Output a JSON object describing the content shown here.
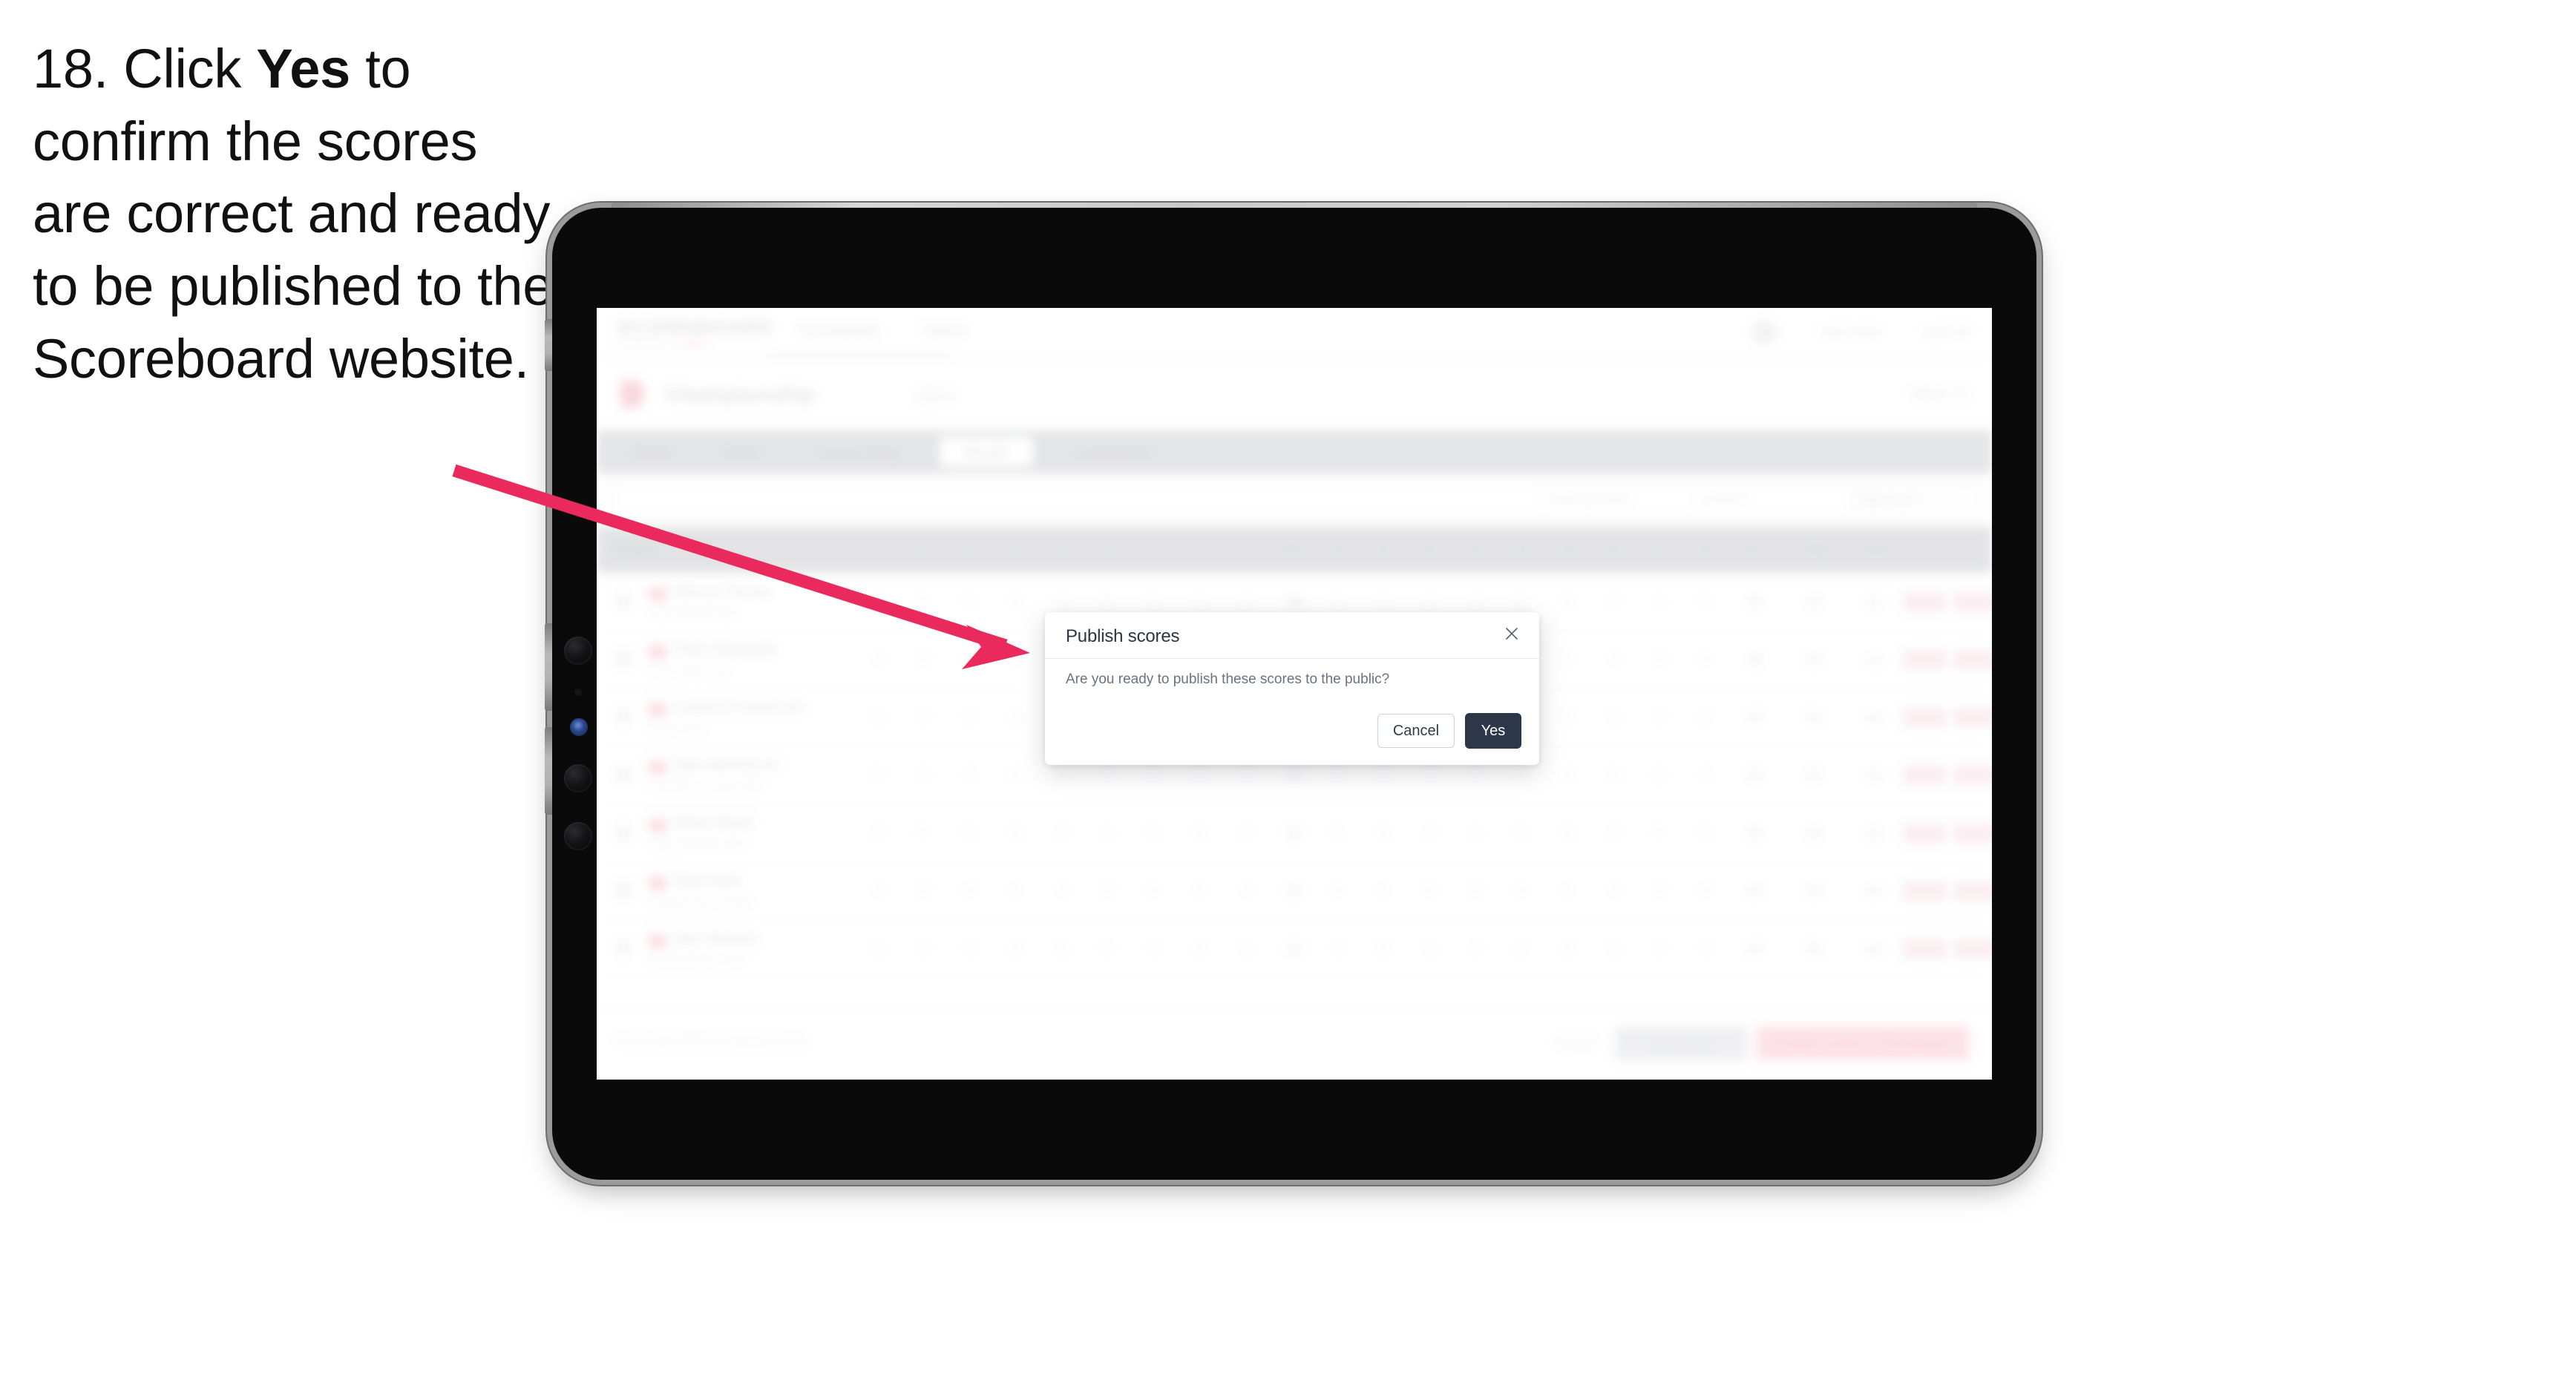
{
  "instruction": {
    "step_number": "18.",
    "text_before": " Click ",
    "emphasis": "Yes",
    "text_after": " to confirm the scores are correct and ready to be published to the Scoreboard website."
  },
  "annotation": {
    "arrow_color": "#ea2a5c",
    "points_to": "modal-dialog"
  },
  "device": {
    "type": "tablet",
    "orientation": "landscape",
    "bezel_color": "#0a0a0a",
    "frame_color": "#9b9b9b"
  },
  "app": {
    "brand": {
      "logo": "SCOREBOARD",
      "tagline": "POWERED BY",
      "tagline_accent": "GOLF"
    },
    "nav": {
      "links": [
        "Tournaments",
        "Teams"
      ],
      "user": "Tom Coles",
      "signout": "Sign out"
    },
    "page": {
      "title": "Championship",
      "meta": "2024",
      "right_label": "Week 12"
    },
    "tabs": [
      {
        "label": "Details",
        "active": false
      },
      {
        "label": "Teams",
        "active": false
      },
      {
        "label": "Course Setup",
        "active": false
      },
      {
        "label": "Results",
        "active": true
      },
      {
        "label": "Leaderboard",
        "active": false
      }
    ],
    "filters": {
      "search_placeholder": "Search players",
      "select_1": "Filter by round",
      "select_2": "Round 1",
      "select_3": "Table view"
    },
    "table": {
      "player_header": "Player",
      "hole_headers": [
        "1",
        "2",
        "3",
        "4",
        "5",
        "6",
        "7",
        "8",
        "9",
        "OUT",
        "10",
        "11",
        "12",
        "13",
        "14",
        "15",
        "16",
        "17",
        "18",
        "IN"
      ],
      "total_header": "Total",
      "score_header": "Score",
      "rows": [
        {
          "name": "Marcus Turner",
          "club": "Oak Hill Golf Club",
          "holes": [
            "4",
            "5",
            "3",
            "4",
            "4",
            "5",
            "4",
            "3",
            "4",
            "36",
            "4",
            "4",
            "5",
            "3",
            "4",
            "4",
            "5",
            "4",
            "4",
            "37"
          ],
          "total": "73",
          "score": "+1",
          "pill_a": "R1",
          "pill_b": "73"
        },
        {
          "name": "Peter Reynolds",
          "club": "Pine Valley Club",
          "holes": [
            "4",
            "4",
            "4",
            "5",
            "3",
            "4",
            "4",
            "4",
            "5",
            "37",
            "3",
            "5",
            "4",
            "4",
            "4",
            "5",
            "4",
            "3",
            "4",
            "36"
          ],
          "total": "73",
          "score": "+1",
          "pill_a": "R1",
          "pill_b": "73"
        },
        {
          "name": "Cameron Anderson",
          "club": "Royal Links",
          "holes": [
            "5",
            "4",
            "3",
            "4",
            "4",
            "4",
            "5",
            "4",
            "4",
            "37",
            "4",
            "4",
            "4",
            "5",
            "3",
            "4",
            "4",
            "4",
            "5",
            "37"
          ],
          "total": "74",
          "score": "+2",
          "pill_a": "R1",
          "pill_b": "74"
        },
        {
          "name": "Dale Westwood",
          "club": "Riverside Country Club",
          "holes": [
            "4",
            "4",
            "4",
            "4",
            "5",
            "3",
            "4",
            "5",
            "4",
            "37",
            "4",
            "5",
            "4",
            "4",
            "4",
            "4",
            "3",
            "5",
            "4",
            "37"
          ],
          "total": "74",
          "score": "+2",
          "pill_a": "R1",
          "pill_b": "74"
        },
        {
          "name": "Oliver Reed",
          "club": "Highland Golf Links",
          "holes": [
            "4",
            "5",
            "4",
            "3",
            "4",
            "4",
            "4",
            "4",
            "5",
            "37",
            "5",
            "4",
            "4",
            "4",
            "4",
            "3",
            "4",
            "5",
            "4",
            "37"
          ],
          "total": "74",
          "score": "+2",
          "pill_a": "R1",
          "pill_b": "74"
        },
        {
          "name": "Ryan Ellis",
          "club": "Seaview Golf Course",
          "holes": [
            "4",
            "4",
            "5",
            "4",
            "4",
            "4",
            "3",
            "5",
            "4",
            "37",
            "4",
            "4",
            "5",
            "4",
            "3",
            "4",
            "4",
            "4",
            "5",
            "37"
          ],
          "total": "75",
          "score": "+3",
          "pill_a": "R1",
          "pill_b": "75"
        },
        {
          "name": "Nick Rowley",
          "club": "Meadowbrook Club",
          "holes": [
            "5",
            "4",
            "4",
            "4",
            "3",
            "5",
            "4",
            "4",
            "4",
            "37",
            "4",
            "5",
            "4",
            "3",
            "5",
            "4",
            "4",
            "4",
            "4",
            "37"
          ],
          "total": "75",
          "score": "+3",
          "pill_a": "R1",
          "pill_b": "75"
        }
      ]
    },
    "footer": {
      "note": "Results published successfully",
      "link": "Cancel",
      "secondary_button": "Save draft",
      "primary_button": "Publish scores to Scoreboard"
    }
  },
  "modal": {
    "title": "Publish scores",
    "body": "Are you ready to publish these scores to the public?",
    "cancel_label": "Cancel",
    "confirm_label": "Yes",
    "close_icon": "close-icon",
    "confirm_color": "#2c3749",
    "cancel_border_color": "#c8d4e6"
  }
}
